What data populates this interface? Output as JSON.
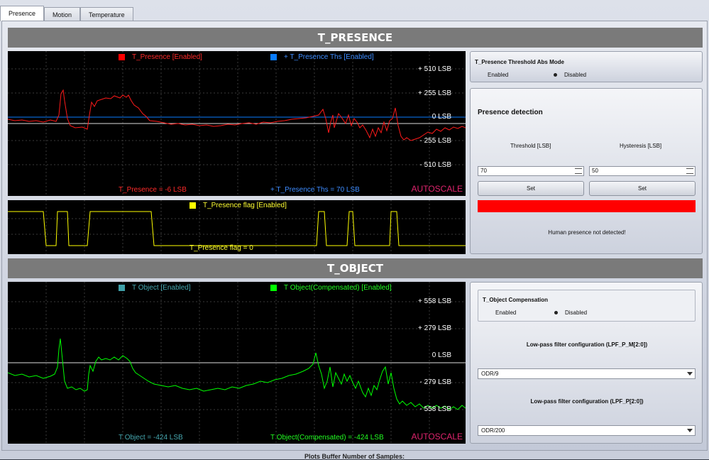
{
  "tabs": [
    {
      "label": "Presence"
    },
    {
      "label": "Motion"
    },
    {
      "label": "Temperature"
    }
  ],
  "presence": {
    "title": "T_PRESENCE",
    "legend": [
      {
        "label": "T_Presence [Enabled]",
        "color": "#ff0000"
      },
      {
        "label": "+ T_Presence Ths [Enabled]",
        "color": "#0a7cff"
      }
    ],
    "yticks": [
      "+ 510 LSB",
      "+ 255 LSB",
      "0 LSB",
      "- 255 LSB",
      "- 510 LSB"
    ],
    "readout_value": "T_Presence = -6 LSB",
    "readout_ths": "+ T_Presence Ths = 70 LSB",
    "autoscale": "AUTOSCALE",
    "flag_legend": "T_Presence flag [Enabled]",
    "flag_color": "#ffff00",
    "flag_readout": "T_Presence flag = 0"
  },
  "threshold_mode": {
    "title": "T_Presence Threshold Abs Mode",
    "options": [
      "Enabled",
      "Disabled"
    ],
    "selected": "Disabled"
  },
  "detection": {
    "title": "Presence detection",
    "threshold_label": "Threshold [LSB]",
    "hysteresis_label": "Hysteresis [LSB]",
    "threshold_value": "70",
    "hysteresis_value": "50",
    "set_label": "Set",
    "indicator_color": "#ff0000",
    "status": "Human presence not detected!"
  },
  "object": {
    "title": "T_OBJECT",
    "legend": [
      {
        "label": "T Object [Enabled]",
        "color": "#3fa0a8"
      },
      {
        "label": "T Object(Compensated) [Enabled]",
        "color": "#00ff00"
      }
    ],
    "yticks": [
      "+ 558 LSB",
      "+ 279 LSB",
      "0 LSB",
      "- 279 LSB",
      "- 558 LSB"
    ],
    "readout_obj": "T Object = -424 LSB",
    "readout_comp": "T Object(Compensated) = -424 LSB",
    "autoscale": "AUTOSCALE"
  },
  "compensation": {
    "title": "T_Object Compensation",
    "options": [
      "Enabled",
      "Disabled"
    ],
    "selected": "Disabled",
    "lpf1_label": "Low-pass filter configuration (LPF_P_M[2:0])",
    "lpf1_value": "ODR/9",
    "lpf2_label": "Low-pass filter configuration (LPF_P[2:0])",
    "lpf2_value": "ODR/200"
  },
  "footer": "Plots Buffer Number of Samples:"
}
